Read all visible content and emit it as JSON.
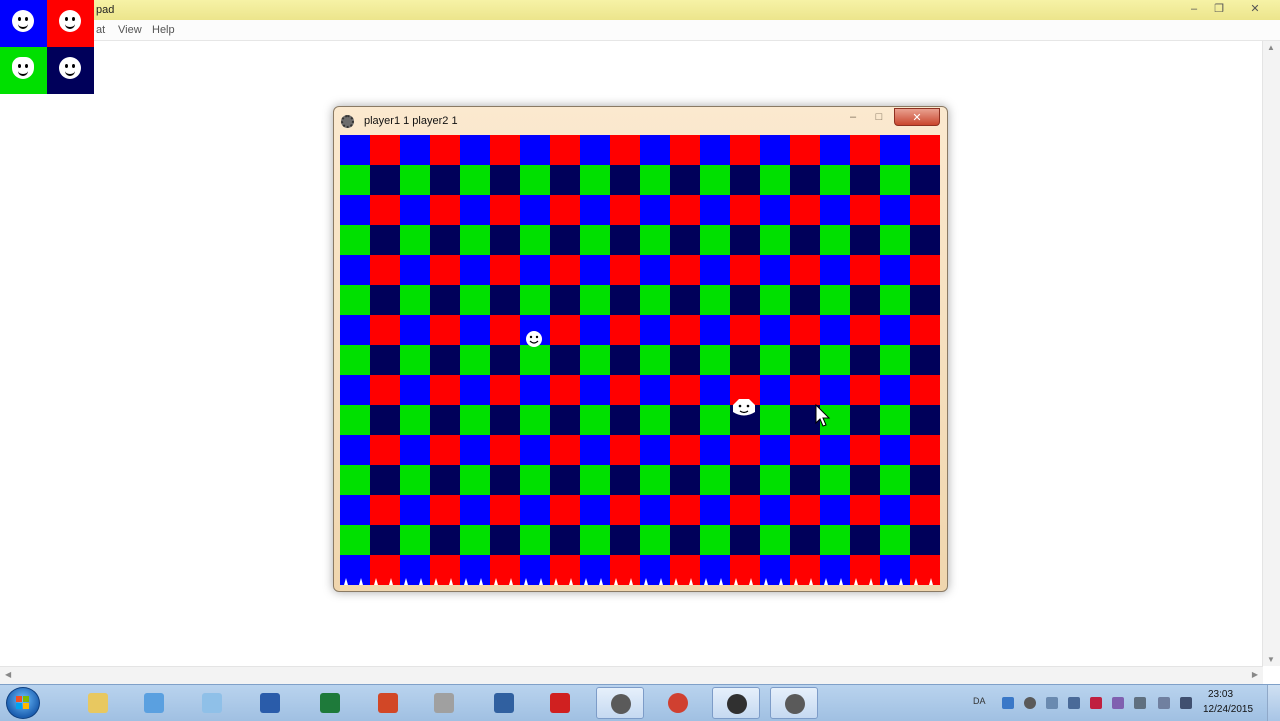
{
  "notepad": {
    "title": "pad",
    "menus": [
      "at",
      "View",
      "Help"
    ],
    "controls": {
      "minimize": "–",
      "restore": "❐",
      "close": "✕"
    }
  },
  "sprite_palette": [
    {
      "name": "player1-face",
      "bg": "#0000ff"
    },
    {
      "name": "player2-face",
      "bg": "#ff0000"
    },
    {
      "name": "hat-face",
      "bg": "#00e000"
    },
    {
      "name": "face-navy",
      "bg": "#00005a"
    }
  ],
  "game_window": {
    "title": "player1 1 player2 1",
    "controls": {
      "minimize": "–",
      "maximize": "□",
      "close": "✕"
    }
  },
  "board": {
    "columns": 20,
    "rows": 15,
    "colors": {
      "blue": "#0000ff",
      "red": "#ff0000",
      "green": "#00e000",
      "navy": "#00005a"
    }
  },
  "taskbar": {
    "apps": [
      {
        "name": "explorer-icon",
        "color": "#e8c860"
      },
      {
        "name": "paint-icon",
        "color": "#5aa0e0"
      },
      {
        "name": "notepad-icon",
        "color": "#8fc0e8"
      },
      {
        "name": "word-icon",
        "color": "#2a5caa"
      },
      {
        "name": "excel-icon",
        "color": "#1e7a3a"
      },
      {
        "name": "powerpoint-icon",
        "color": "#d24726"
      },
      {
        "name": "game-icon",
        "color": "#a0a0a0"
      },
      {
        "name": "spider-icon",
        "color": "#3060a0"
      },
      {
        "name": "balloon-icon",
        "color": "#d02020"
      },
      {
        "name": "gamemaker-icon",
        "color": "#5a5a5a"
      },
      {
        "name": "chrome-icon",
        "color": "#d04030"
      },
      {
        "name": "obs-icon",
        "color": "#303030"
      },
      {
        "name": "gamemaker-runner-icon",
        "color": "#5a5a5a"
      }
    ],
    "language": "DA",
    "time": "23:03",
    "date": "12/24/2015"
  }
}
